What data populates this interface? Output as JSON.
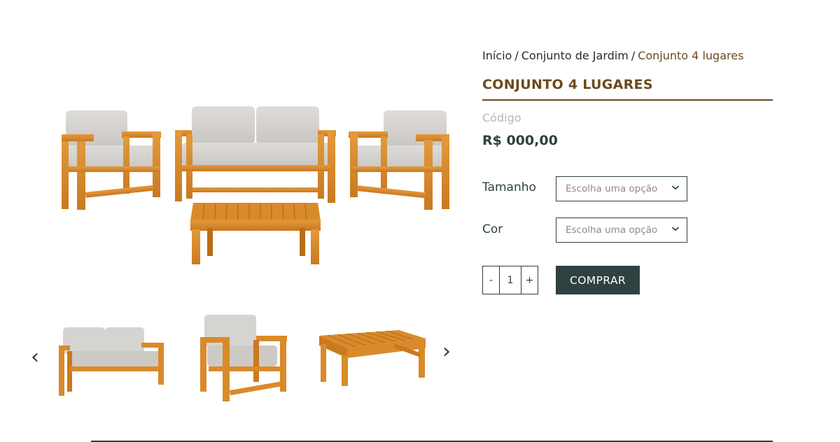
{
  "breadcrumb": {
    "home": "Início",
    "separator": "/",
    "category": "Conjunto de Jardim",
    "current": "Conjunto 4 lugares"
  },
  "product": {
    "title": "CONJUNTO 4 LUGARES",
    "code_label": "Código",
    "price": "R$ 000,00"
  },
  "options": {
    "size_label": "Tamanho",
    "size_placeholder": "Escolha uma opção",
    "color_label": "Cor",
    "color_placeholder": "Escolha uma opção"
  },
  "quantity": {
    "minus": "-",
    "value": "1",
    "plus": "+"
  },
  "buy_button": "COMPRAR",
  "gallery": {
    "prev": "‹",
    "next": "›",
    "thumbnails": [
      "sofa-2-lugares",
      "poltrona",
      "mesa-de-centro"
    ]
  },
  "colors": {
    "accent": "#6b4a1e",
    "dark": "#2f4141",
    "wood": "#d98a2b",
    "cushion": "#d6d4d1"
  }
}
